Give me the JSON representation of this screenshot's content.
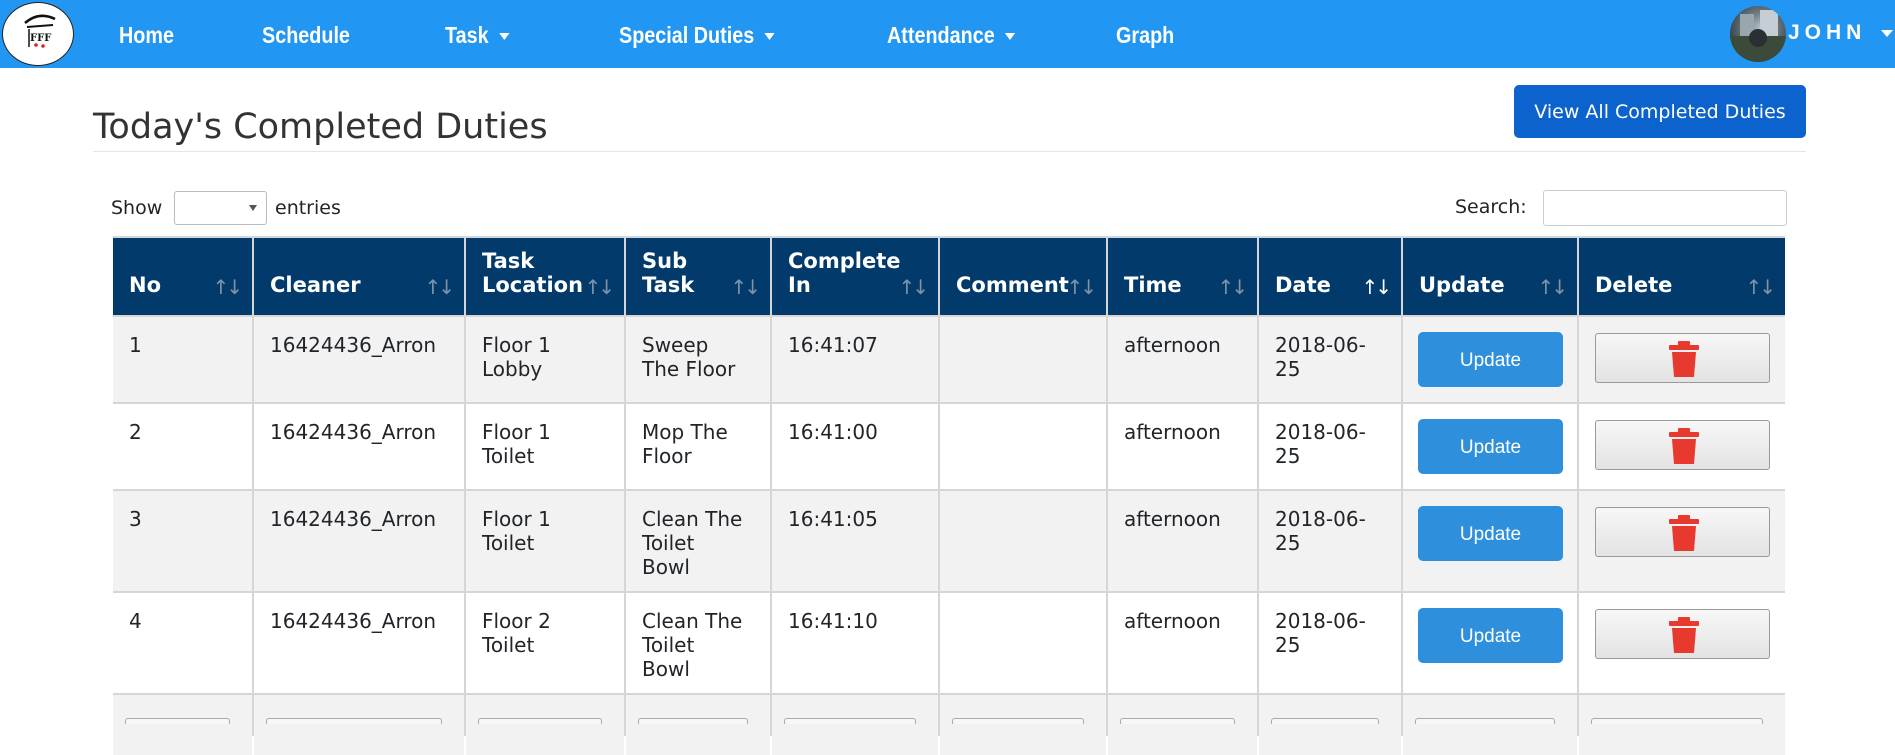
{
  "nav": {
    "items": [
      {
        "label": "Home",
        "dropdown": false
      },
      {
        "label": "Schedule",
        "dropdown": false
      },
      {
        "label": "Task",
        "dropdown": true
      },
      {
        "label": "Special Duties",
        "dropdown": true
      },
      {
        "label": "Attendance",
        "dropdown": true
      },
      {
        "label": "Graph",
        "dropdown": false
      }
    ],
    "user": "JOHN",
    "logo_text": "FFF"
  },
  "page": {
    "title": "Today's Completed Duties",
    "view_all_label": "View All Completed Duties"
  },
  "controls": {
    "show_label": "Show",
    "entries_label": "entries",
    "search_label": "Search:",
    "search_value": ""
  },
  "table": {
    "columns": [
      {
        "label": "No"
      },
      {
        "label": "Cleaner"
      },
      {
        "label": "Task\nLocation"
      },
      {
        "label": "Sub\nTask"
      },
      {
        "label": "Complete\nIn"
      },
      {
        "label": "Comment"
      },
      {
        "label": "Time"
      },
      {
        "label": "Date",
        "sorted": true
      },
      {
        "label": "Update"
      },
      {
        "label": "Delete"
      }
    ],
    "rows": [
      {
        "no": "1",
        "cleaner": "16424436_Arron",
        "location": "Floor 1\nLobby",
        "subtask": "Sweep\nThe Floor",
        "complete_in": "16:41:07",
        "comment": "",
        "time": "afternoon",
        "date": "2018-06-\n25"
      },
      {
        "no": "2",
        "cleaner": "16424436_Arron",
        "location": "Floor 1\nToilet",
        "subtask": "Mop The\nFloor",
        "complete_in": "16:41:00",
        "comment": "",
        "time": "afternoon",
        "date": "2018-06-\n25"
      },
      {
        "no": "3",
        "cleaner": "16424436_Arron",
        "location": "Floor 1\nToilet",
        "subtask": "Clean The\nToilet\nBowl",
        "complete_in": "16:41:05",
        "comment": "",
        "time": "afternoon",
        "date": "2018-06-\n25"
      },
      {
        "no": "4",
        "cleaner": "16424436_Arron",
        "location": "Floor 2\nToilet",
        "subtask": "Clean The\nToilet\nBowl",
        "complete_in": "16:41:10",
        "comment": "",
        "time": "afternoon",
        "date": "2018-06-\n25"
      }
    ],
    "update_label": "Update",
    "sort_glyph": "↑↓",
    "colors": {
      "header": "#013a6b",
      "update": "#2e8fdd",
      "delete_icon": "#e8392f",
      "navbar": "#2196f3"
    }
  }
}
